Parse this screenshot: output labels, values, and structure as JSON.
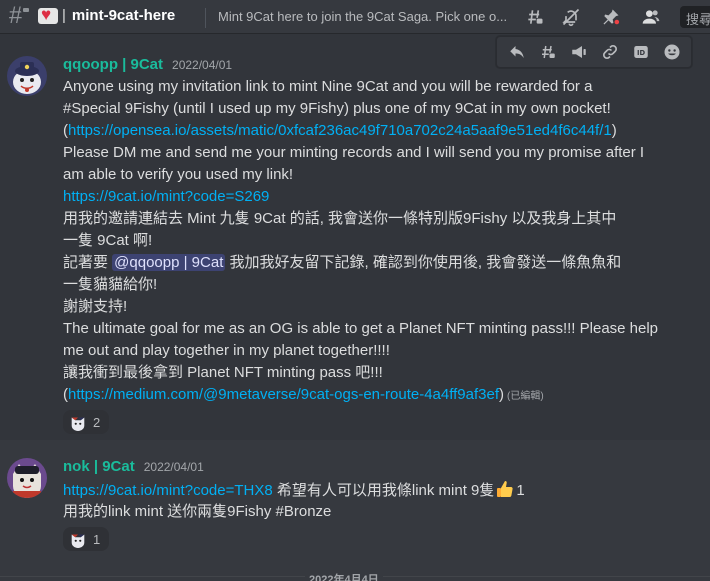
{
  "header": {
    "channel_name": "mint-9cat-here",
    "channel_separator": "|",
    "topic": "Mint 9Cat here to join the 9Cat Saga. Pick one o...",
    "search_placeholder": "搜尋"
  },
  "messages": [
    {
      "author": "qqoopp | 9Cat",
      "timestamp": "2022/04/01",
      "lines": {
        "l1": "Anyone using my invitation link to mint Nine 9Cat and you will be rewarded for a",
        "l2": "#Special 9Fishy (until I used up my 9Fishy) plus one of my 9Cat in my own pocket!",
        "l3_open": "(",
        "l3_link": "https://opensea.io/assets/matic/0xfcaf236ac49f710a702c24a5aaf9e51ed4f6c44f/1",
        "l3_close": ")",
        "l4": "Please DM me and send me your minting records and I will send you my promise after I",
        "l5": "am able to verify you used my link!",
        "l6_link": "https://9cat.io/mint?code=S269",
        "l7": "用我的邀請連結去 Mint 九隻 9Cat 的話, 我會送你一條特別版9Fishy 以及我身上其中",
        "l8": "一隻 9Cat 啊!",
        "l9_pre": "記著要 ",
        "l9_mention": "@qqoopp | 9Cat",
        "l9_post": " 我加我好友留下記錄, 確認到你使用後, 我會發送一條魚魚和",
        "l10": "一隻貓貓給你!",
        "l11": "謝謝支持!",
        "l12": "The ultimate goal for me as an OG is able to get a Planet NFT minting pass!!! Please help",
        "l13": "me out and play together in my planet together!!!!",
        "l14": "讓我衝到最後拿到 Planet NFT minting pass 吧!!!",
        "l15_open": "(",
        "l15_link": "https://medium.com/@9metaverse/9cat-ogs-en-route-4a4ff9af3ef",
        "l15_close": ")",
        "edited": "(已編輯)"
      },
      "reaction_count": "2"
    },
    {
      "author": "nok | 9Cat",
      "timestamp": "2022/04/01",
      "lines": {
        "l1_link": "https://9cat.io/mint?code=THX8",
        "l1_text": " 希望有人可以用我條link mint 9隻",
        "l1_after": "1",
        "l2": "用我的link mint 送你兩隻9Fishy #Bronze"
      },
      "reaction_count": "1"
    }
  ],
  "date_divider": "2022年4月4日",
  "colors": {
    "background": "#36393f",
    "author": "#1abc9c",
    "link": "#00b0f4",
    "mention_bg": "#414675"
  },
  "icons": {
    "header": [
      "threads-icon",
      "mute-icon",
      "pin-icon",
      "members-icon"
    ],
    "actions": [
      "reply-icon",
      "thread-icon",
      "speaker-icon",
      "link-icon",
      "id-icon",
      "emoji-icon"
    ]
  }
}
